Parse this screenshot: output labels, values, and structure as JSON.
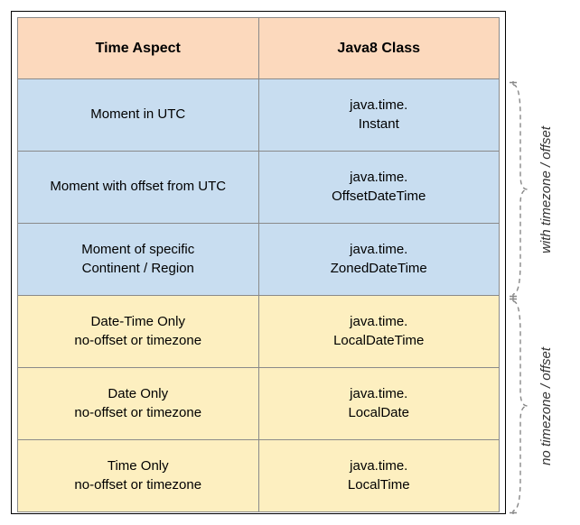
{
  "headers": {
    "time_aspect": "Time Aspect",
    "java_class": "Java8 Class"
  },
  "rows": [
    {
      "aspect_l1": "Moment in UTC",
      "aspect_l2": "",
      "pkg": "java.time.",
      "cls": "Instant",
      "group": "with"
    },
    {
      "aspect_l1": "Moment with offset from UTC",
      "aspect_l2": "",
      "pkg": "java.time.",
      "cls": "OffsetDateTime",
      "group": "with"
    },
    {
      "aspect_l1": "Moment of specific",
      "aspect_l2": "Continent / Region",
      "pkg": "java.time.",
      "cls": "ZonedDateTime",
      "group": "with"
    },
    {
      "aspect_l1": "Date-Time Only",
      "aspect_l2": "no-offset or timezone",
      "pkg": "java.time.",
      "cls": "LocalDateTime",
      "group": "no"
    },
    {
      "aspect_l1": "Date Only",
      "aspect_l2": "no-offset or timezone",
      "pkg": "java.time.",
      "cls": "LocalDate",
      "group": "no"
    },
    {
      "aspect_l1": "Time Only",
      "aspect_l2": "no-offset or timezone",
      "pkg": "java.time.",
      "cls": "LocalTime",
      "group": "no"
    }
  ],
  "brackets": {
    "with": "with timezone  / offset",
    "no": "no timezone / offset"
  }
}
